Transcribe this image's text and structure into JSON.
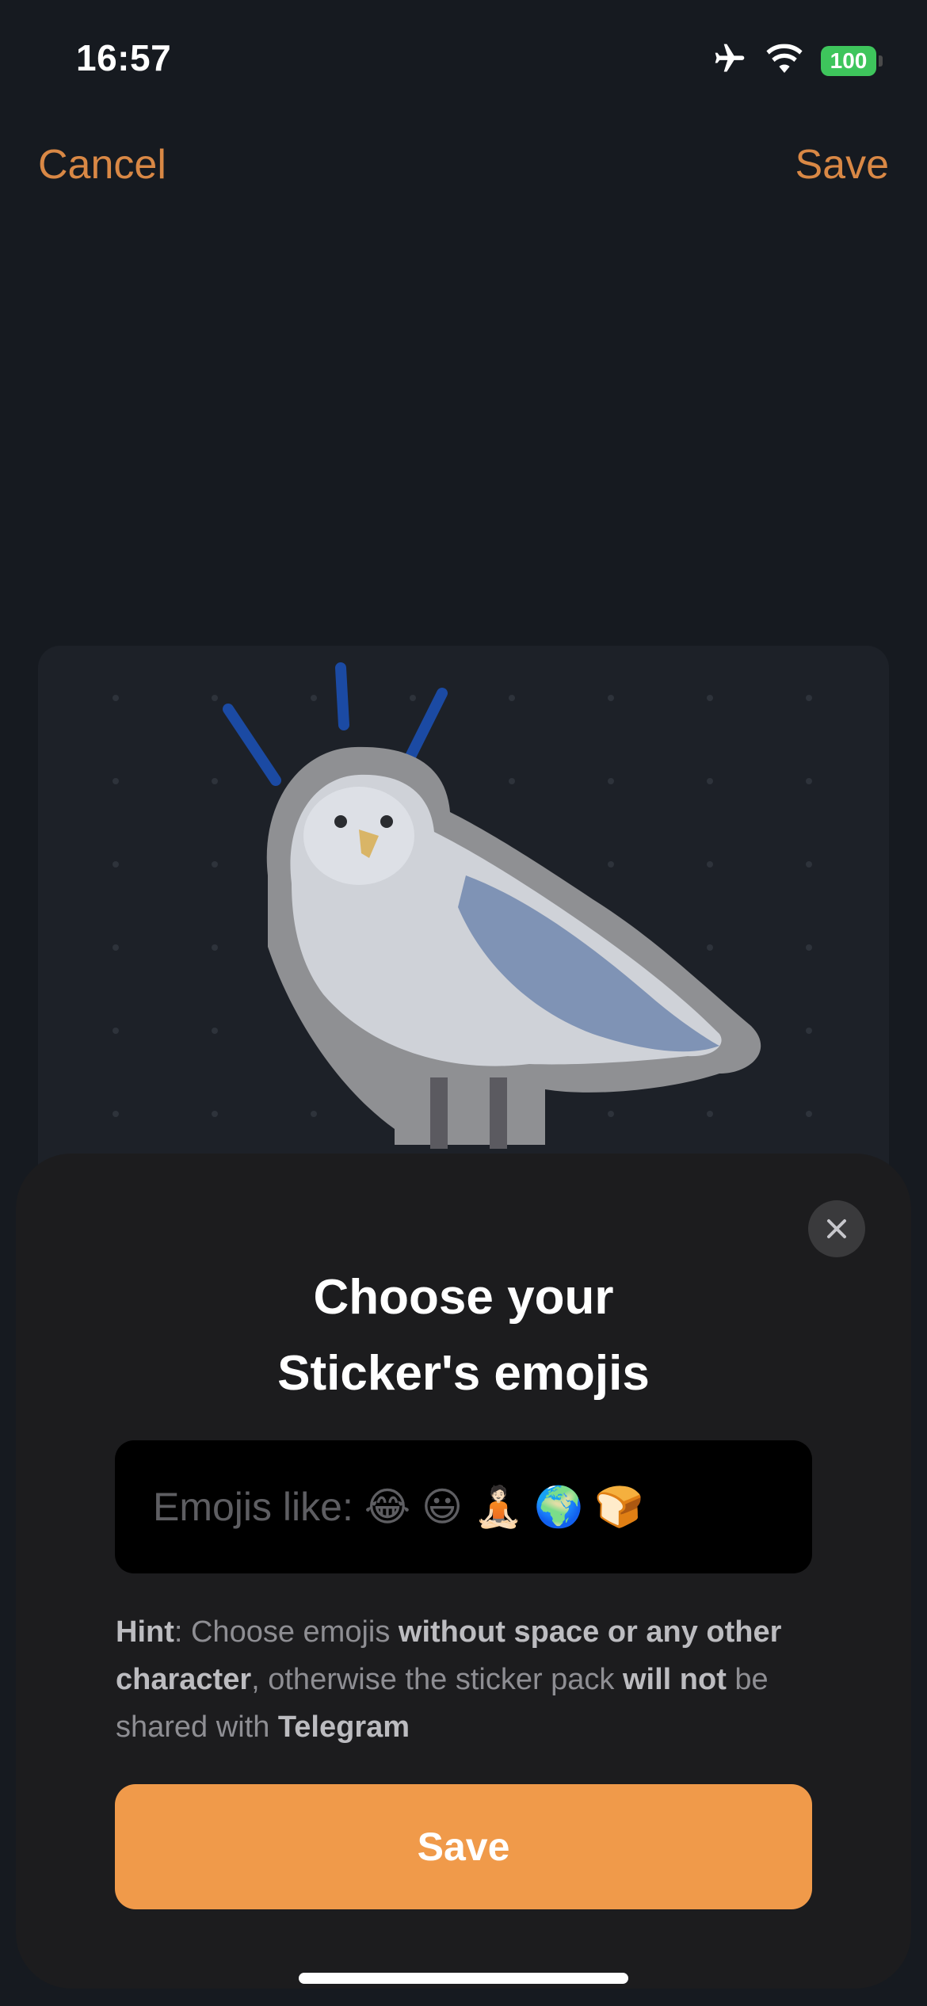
{
  "status_bar": {
    "time": "16:57",
    "battery": "100"
  },
  "nav": {
    "cancel_label": "Cancel",
    "save_label": "Save"
  },
  "sheet": {
    "title_line1": "Choose your",
    "title_line2": "Sticker's emojis",
    "input_placeholder": "Emojis like: 😂 😃 🧘🏻 🌍 🍞",
    "hint": {
      "p1": "Hint",
      "p2": ": Choose emojis ",
      "p3": "without space or any other character",
      "p4": ", otherwise the sticker pack ",
      "p5": "will not",
      "p6": " be shared with ",
      "p7": "Telegram"
    },
    "save_label": "Save"
  },
  "colors": {
    "accent": "#f09a4a",
    "nav_accent": "#d98845",
    "background": "#161a20",
    "sheet": "#1c1c1e",
    "battery": "#3ec55c"
  },
  "icons": {
    "airplane": "airplane-icon",
    "wifi": "wifi-icon",
    "battery": "battery-icon",
    "close": "close-icon"
  }
}
